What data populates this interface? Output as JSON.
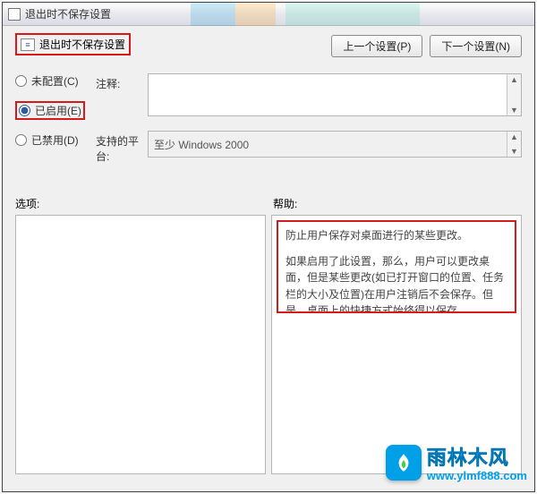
{
  "window": {
    "title": "退出时不保存设置"
  },
  "header": {
    "policy_title": "退出时不保存设置",
    "prev_button": "上一个设置(P)",
    "prev_key": "P",
    "next_button": "下一个设置(N)",
    "next_key": "N"
  },
  "config": {
    "radios": {
      "not_configured": {
        "label": "未配置(C)",
        "key": "C"
      },
      "enabled": {
        "label": "已启用(E)",
        "key": "E",
        "selected": true
      },
      "disabled": {
        "label": "已禁用(D)",
        "key": "D"
      }
    },
    "comment_label": "注释:",
    "comment_value": "",
    "supported_label": "支持的平台:",
    "supported_value": "至少 Windows 2000"
  },
  "lower": {
    "options_label": "选项:",
    "help_label": "帮助:",
    "help_text_1": "防止用户保存对桌面进行的某些更改。",
    "help_text_2": "如果启用了此设置，那么，用户可以更改桌面，但是某些更改(如已打开窗口的位置、任务栏的大小及位置)在用户注销后不会保存。但是，桌面上的快捷方式始终得以保存。"
  },
  "watermark": {
    "title": "雨林木风",
    "url": "www.ylmf888.com"
  },
  "icons": {
    "policy": "policy-icon",
    "scroll_up": "▲",
    "scroll_down": "▼"
  }
}
